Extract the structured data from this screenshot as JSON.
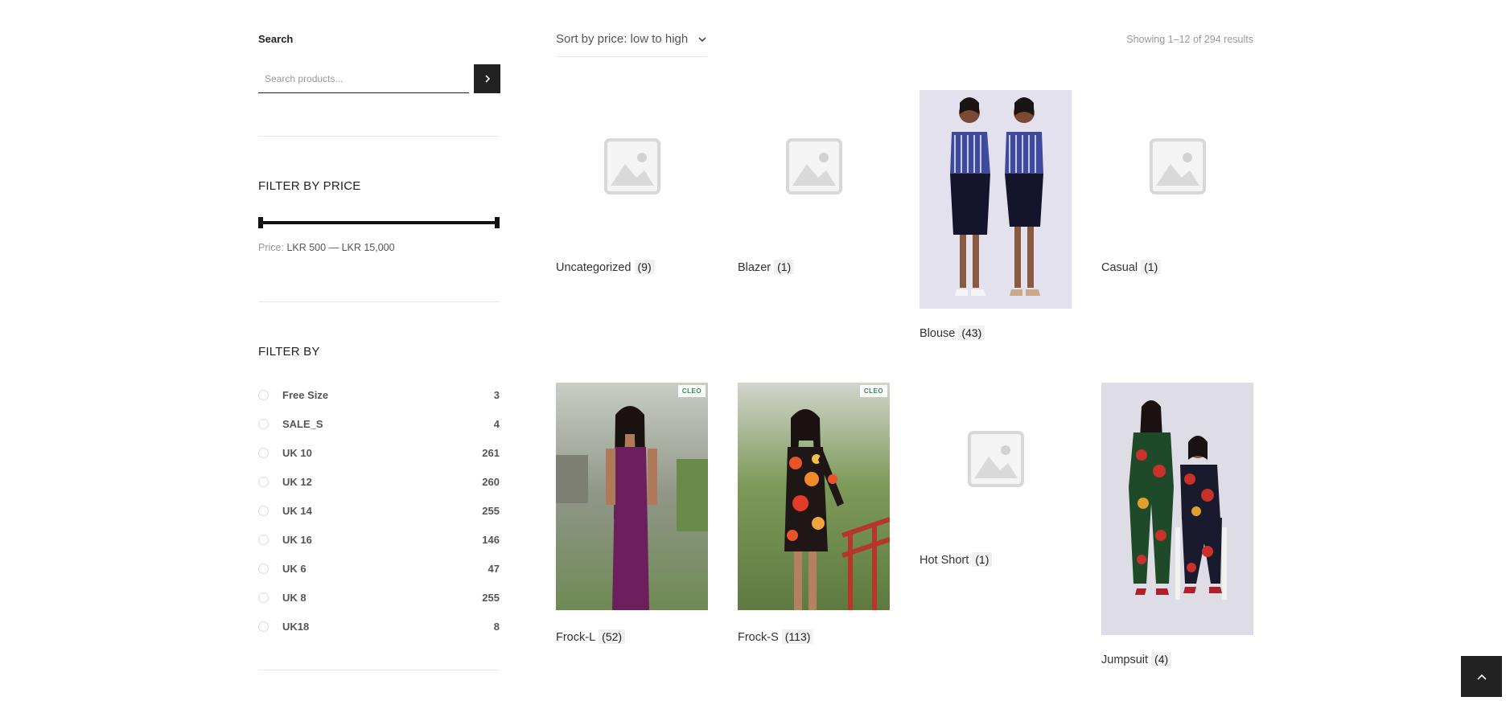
{
  "sidebar": {
    "search": {
      "title": "Search",
      "placeholder": "Search products..."
    },
    "price_filter": {
      "title": "FILTER BY PRICE",
      "price_prefix": "Price:",
      "min": "LKR 500",
      "separator": "—",
      "max": "LKR 15,000"
    },
    "attribute_filter": {
      "title": "FILTER BY",
      "items": [
        {
          "label": "Free Size",
          "count": "3"
        },
        {
          "label": "SALE_S",
          "count": "4"
        },
        {
          "label": "UK 10",
          "count": "261"
        },
        {
          "label": "UK 12",
          "count": "260"
        },
        {
          "label": "UK 14",
          "count": "255"
        },
        {
          "label": "UK 16",
          "count": "146"
        },
        {
          "label": "UK 6",
          "count": "47"
        },
        {
          "label": "UK 8",
          "count": "255"
        },
        {
          "label": "UK18",
          "count": "8"
        }
      ]
    }
  },
  "toolbar": {
    "sort_label": "Sort by price: low to high",
    "result_count": "Showing 1–12 of 294 results"
  },
  "categories": [
    {
      "name": "Uncategorized",
      "count": "(9)"
    },
    {
      "name": "Blazer",
      "count": "(1)"
    },
    {
      "name": "Blouse",
      "count": "(43)"
    },
    {
      "name": "Casual",
      "count": "(1)"
    },
    {
      "name": "Frock-L",
      "count": "(52)"
    },
    {
      "name": "Frock-S",
      "count": "(113)"
    },
    {
      "name": "Hot Short",
      "count": "(1)"
    },
    {
      "name": "Jumpsuit",
      "count": "(4)"
    }
  ],
  "brand_logo_text": "CLEO",
  "colors": {
    "accent": "#222222",
    "muted_text": "#999999",
    "divider": "#e8e8e8"
  },
  "icons": {
    "search_button": "chevron-right-icon",
    "sort": "chevron-down-icon",
    "back_to_top": "chevron-up-icon",
    "placeholder": "image-placeholder-icon"
  }
}
